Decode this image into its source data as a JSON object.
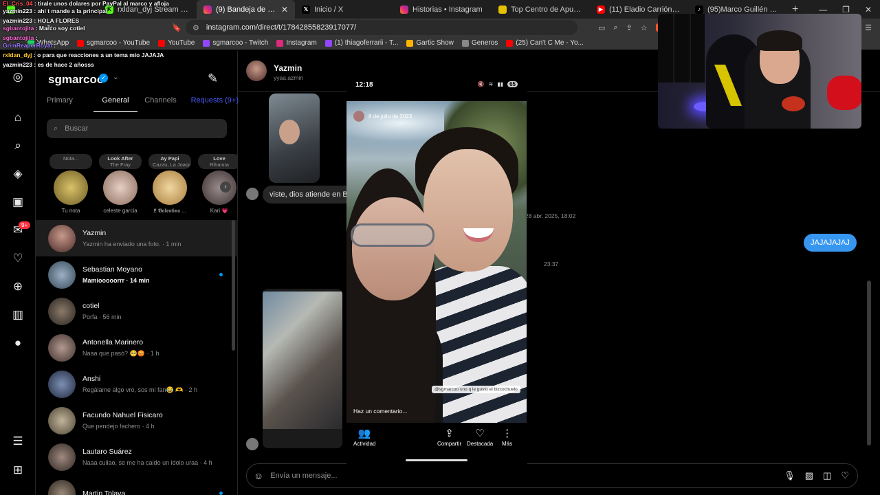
{
  "tabs": [
    {
      "title": "",
      "fav_color": "#53fc18"
    },
    {
      "title": "rxldan_dyj Stream - Watch Live",
      "fav_color": "#53fc18",
      "fav_text": "K"
    },
    {
      "title": "(9) Bandeja de entrada • C",
      "fav_color": "#d62976",
      "active": true
    },
    {
      "title": "Inicio / X",
      "fav_color": "#000000",
      "fav_text": "X"
    },
    {
      "title": "Historias • Instagram",
      "fav_color": "#d62976"
    },
    {
      "title": "Top Centro de Apuestas Depo",
      "fav_color": "#e5c100"
    },
    {
      "title": "(11) Eladio Carrión Ft. Bizarrap",
      "fav_color": "#ff0000"
    },
    {
      "title": "(95)Marco Guillén 🍩 (@sgmar",
      "fav_color": "#000000"
    }
  ],
  "url": "instagram.com/direct/t/17842855823917077/",
  "bookmarks": [
    "WhatsApp",
    "sgmarcoo - YouTube",
    "YouTube",
    "sgmarcoo - Twitch",
    "Instagram",
    "(1) thiagoferrarii - T...",
    "Gartic Show",
    "Generos",
    "(25) Can't C Me - Yo..."
  ],
  "chat": [
    {
      "user": "El_Cris_04",
      "text": "tirale unos dolares por PayPal al marco y afloja",
      "color": "#ff4b4b"
    },
    {
      "user": "yazmin223",
      "text": "ahi t mande a la principal",
      "color": "#ffffff"
    },
    {
      "user": "yazmin223",
      "text": "HOLA FLORES",
      "color": "#ffffff"
    },
    {
      "user": "sgbantojita",
      "text": "Marco soy cotiel",
      "color": "#ff6ad5"
    },
    {
      "user": "sgbantojita",
      "text": "",
      "color": "#ff6ad5"
    },
    {
      "user": "GrimReaperRoyal",
      "text": "",
      "color": "#9b7bff"
    },
    {
      "user": "rxldan_dyj",
      "text": "o para que reacciones a un tema mio JAJAJA",
      "color": "#ffcc33"
    },
    {
      "user": "yazmin223",
      "text": "es de hace 2 añosss",
      "color": "#ffffff"
    }
  ],
  "ig": {
    "username": "sgmarcoo",
    "tabs": [
      "Primary",
      "General",
      "Channels",
      "Requests (9+)"
    ],
    "search_placeholder": "Buscar",
    "notes": [
      {
        "bubble": "Nota...",
        "bubble2": "",
        "name": "Tu nota"
      },
      {
        "bubble": "Look After",
        "bubble2": "The Fray",
        "name": "celeste garcia"
      },
      {
        "bubble": "Ay Papi",
        "bubble2": "Cazzu, La Joaqui",
        "name": "𝕷 𝖁𝖆𝖑𝖊𝖓𝖙𝖎𝖓𝖆 ..."
      },
      {
        "bubble": "Love",
        "bubble2": "Rihanna",
        "name": "Kari 💗"
      }
    ],
    "badge": "9+",
    "conversations": [
      {
        "name": "Yazmin",
        "preview": "Yazmin ha enviado una foto. · 1 min",
        "selected": true,
        "unread": false
      },
      {
        "name": "Sebastian Moyano",
        "preview": "Mamiooooorrr · 14 min",
        "selected": false,
        "unread": true
      },
      {
        "name": "cotiel",
        "preview": "Porfa · 56 min",
        "selected": false,
        "unread": false
      },
      {
        "name": "Antonella Marinero",
        "preview": "Naaa que pasó? 🥺😡 · 1 h",
        "selected": false,
        "unread": false
      },
      {
        "name": "Anshi",
        "preview": "Regálame algo vro, sos mi fan😂 🫶 · 2 h",
        "selected": false,
        "unread": false
      },
      {
        "name": "Facundo Nahuel Fisicaro",
        "preview": "Que pendejo fachero · 4 h",
        "selected": false,
        "unread": false
      },
      {
        "name": "Lautaro Suárez",
        "preview": "Naaa culiao, se me ha caido un idolo uraa · 4 h",
        "selected": false,
        "unread": false
      },
      {
        "name": "Martin Tolava",
        "preview": "",
        "selected": false,
        "unread": true
      }
    ],
    "thread": {
      "name": "Yazmin",
      "handle": "yyaa.azmin",
      "message": "viste, dios atiende en Bs",
      "timestamp1": "28 abr. 2025, 18:02",
      "my_message": "JAJAJAJAJ",
      "timestamp2": "23:37",
      "composer_placeholder": "Envía un mensaje..."
    }
  },
  "phone": {
    "time": "12:18",
    "battery": "65",
    "photo_date": "8 de julio de 2023",
    "sticker": "@sgmarcoo uno q le gusto el bizcochuelo",
    "comment_placeholder": "Haz un comentario...",
    "actions": [
      "Actividad",
      "Compartir",
      "Destacada",
      "Más"
    ]
  }
}
